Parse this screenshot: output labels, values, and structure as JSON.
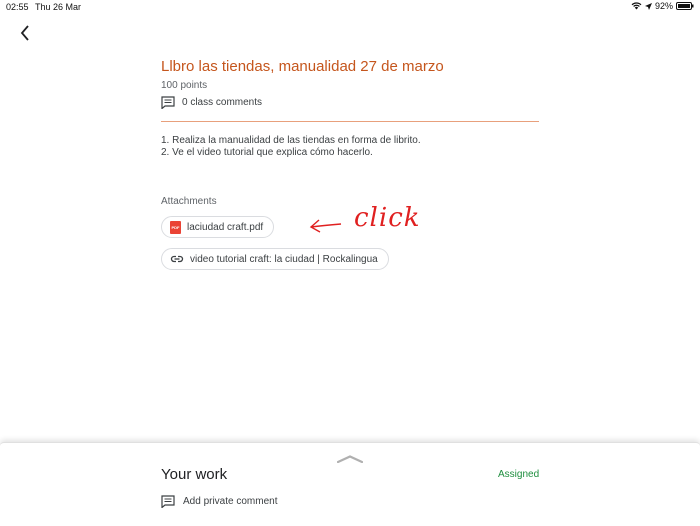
{
  "status_bar": {
    "time": "02:55",
    "date": "Thu 26 Mar",
    "battery": "92%"
  },
  "assignment": {
    "title": "Llbro las tiendas, manualidad 27 de marzo",
    "points": "100 points",
    "class_comments": "0 class comments",
    "instructions": [
      "1. Realiza la manualidad de las tiendas en forma de librito.",
      "2. Ve el video tutorial que explica cómo hacerlo."
    ],
    "attachments_label": "Attachments",
    "attachments": [
      {
        "type": "pdf",
        "label": "laciudad craft.pdf",
        "icon": "pdf-icon"
      },
      {
        "type": "link",
        "label": "video tutorial craft: la ciudad | Rockalingua",
        "icon": "link-icon"
      }
    ]
  },
  "annotation": {
    "text": "click",
    "color": "#e02020"
  },
  "your_work": {
    "title": "Your work",
    "status": "Assigned",
    "private_comment": "Add private comment"
  },
  "colors": {
    "accent": "#c5561d",
    "assigned": "#1e8e3e"
  }
}
